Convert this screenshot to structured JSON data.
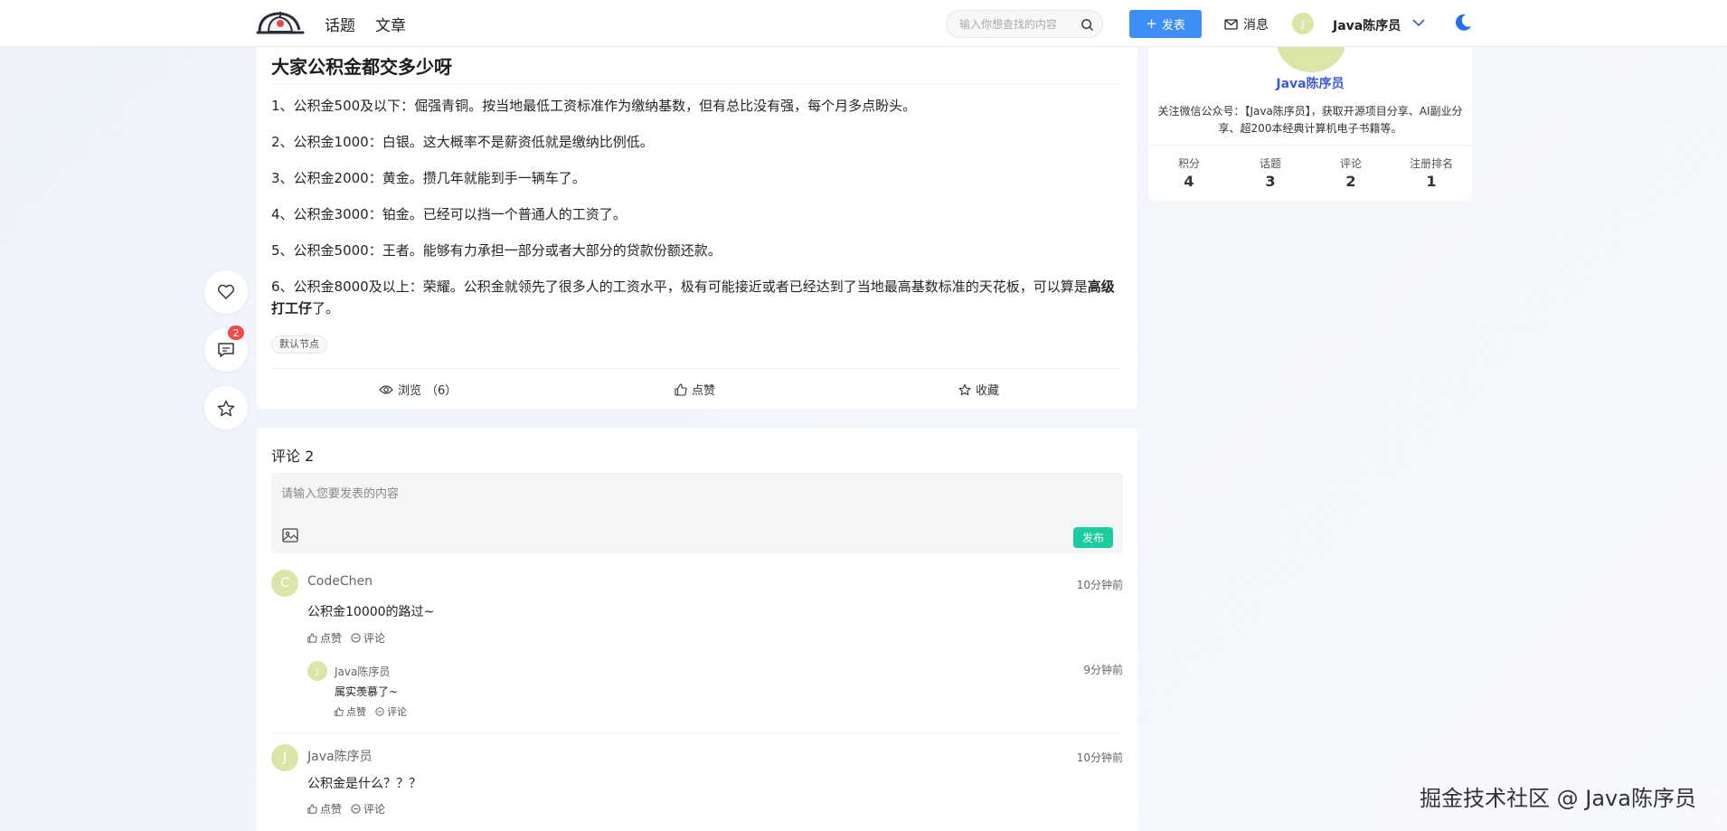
{
  "header": {
    "nav": [
      "话题",
      "文章"
    ],
    "search_placeholder": "输入你想查找的内容",
    "publish_label": "发表",
    "messages_label": "消息",
    "avatar_initial": "J",
    "username": "Java陈序员"
  },
  "float_bar": {
    "comment_count": "2"
  },
  "article": {
    "title": "大家公积金都交多少呀",
    "paragraphs": [
      "1、公积金500及以下：倔强青铜。按当地最低工资标准作为缴纳基数，但有总比没有强，每个月多点盼头。",
      "2、公积金1000：白银。这大概率不是薪资低就是缴纳比例低。",
      "3、公积金2000：黄金。攒几年就能到手一辆车了。",
      "4、公积金3000：铂金。已经可以挡一个普通人的工资了。",
      "5、公积金5000：王者。能够有力承担一部分或者大部分的贷款份额还款。"
    ],
    "paragraph6_pre": "6、公积金8000及以上：荣耀。公积金就领先了很多人的工资水平，极有可能接近或者已经达到了当地最高基数标准的天花板，可以算是",
    "paragraph6_bold": "高级打工仔",
    "paragraph6_post": "了。",
    "tag": "默认节点",
    "views_label": "浏览",
    "views_count": "（6）",
    "like_label": "点赞",
    "favorite_label": "收藏"
  },
  "comments": {
    "title": "评论 2",
    "input_placeholder": "请输入您要发表的内容",
    "submit_label": "发布",
    "items": [
      {
        "initial": "C",
        "author": "CodeChen",
        "time": "10分钟前",
        "text": "公积金10000的路过~",
        "like_label": "点赞",
        "reply_label": "评论",
        "replies": [
          {
            "initial": "J",
            "author": "Java陈序员",
            "time": "9分钟前",
            "text": "属实羡慕了~",
            "like_label": "点赞",
            "reply_label": "评论"
          }
        ]
      },
      {
        "initial": "J",
        "author": "Java陈序员",
        "time": "10分钟前",
        "text": "公积金是什么？？？",
        "like_label": "点赞",
        "reply_label": "评论"
      }
    ]
  },
  "profile": {
    "name": "Java陈序员",
    "description": "关注微信公众号：【Java陈序员】，获取开源项目分享、AI副业分享、超200本经典计算机电子书籍等。",
    "stats": [
      {
        "label": "积分",
        "value": "4"
      },
      {
        "label": "话题",
        "value": "3"
      },
      {
        "label": "评论",
        "value": "2"
      },
      {
        "label": "注册排名",
        "value": "1"
      }
    ]
  },
  "watermark": "掘金技术社区 @ Java陈序员",
  "colors": {
    "accent_blue": "#3e8ef7",
    "submit_green": "#1ccca1",
    "badge_red": "#f04a4a",
    "avatar_bg": "#d9e6a8",
    "profile_name": "#3b5bdb"
  }
}
